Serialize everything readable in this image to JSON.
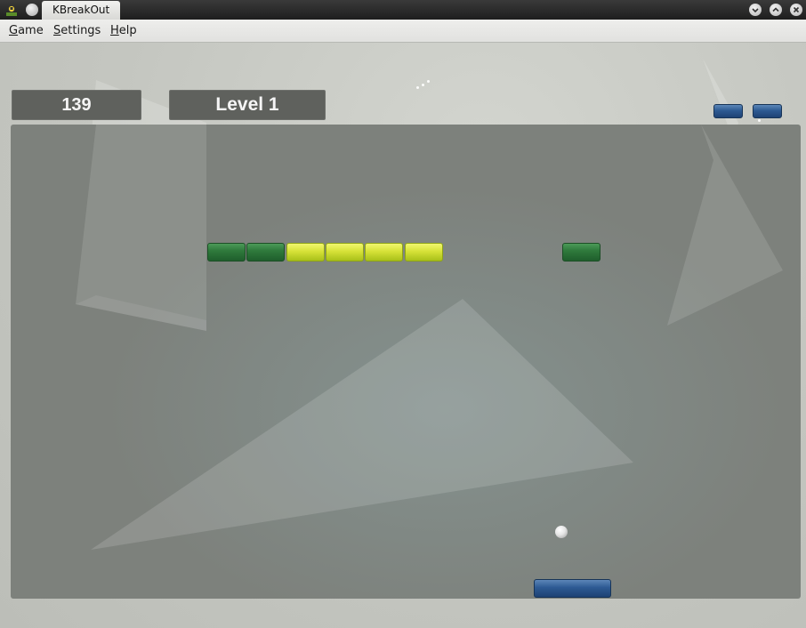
{
  "window": {
    "title": "KBreakOut",
    "icons": [
      "app-icon",
      "window-menu-icon",
      "minimize-icon",
      "maximize-icon",
      "close-icon"
    ]
  },
  "menu": {
    "game_mnemonic": "G",
    "game_rest": "ame",
    "settings_mnemonic": "S",
    "settings_rest": "ettings",
    "help_mnemonic": "H",
    "help_rest": "elp"
  },
  "hud": {
    "score": "139",
    "level": "Level 1",
    "lives_remaining": 2
  },
  "bricks": [
    {
      "color": "green"
    },
    {
      "color": "green"
    },
    {
      "color": "yellow"
    },
    {
      "color": "yellow"
    },
    {
      "color": "yellow"
    },
    {
      "color": "yellow"
    },
    {
      "color": "green"
    }
  ],
  "colors": {
    "background": "#c4c6c0",
    "playfield": "#7d817c",
    "panel": "#5f615d",
    "green_brick": "#2f7a3c",
    "yellow_brick": "#d6e238",
    "blue_paddle": "#2d5a93"
  }
}
